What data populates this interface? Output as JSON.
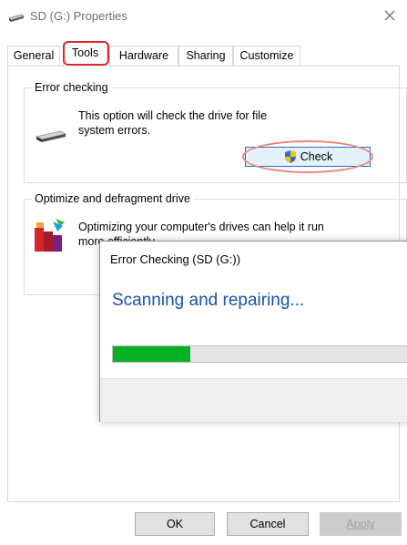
{
  "window": {
    "title": "SD (G:) Properties",
    "title_icon": "drive-icon",
    "close_icon": "close-icon"
  },
  "tabs": [
    {
      "label": "General",
      "active": false
    },
    {
      "label": "Tools",
      "active": true
    },
    {
      "label": "Hardware",
      "active": false
    },
    {
      "label": "Sharing",
      "active": false
    },
    {
      "label": "Customize",
      "active": false
    }
  ],
  "error_checking": {
    "label": "Error checking",
    "line1": "This option will check the drive for file",
    "line2": "system errors.",
    "check_label": "Check",
    "check_icon": "uac-shield-icon"
  },
  "optimize": {
    "label": "Optimize and defragment drive",
    "line1": "Optimizing your computer's drives can help it run",
    "line2": "more efficiently."
  },
  "dialog": {
    "title": "Error Checking (SD (G:))",
    "heading": "Scanning and repairing...",
    "progress": 0.25
  },
  "buttons": {
    "ok": "OK",
    "cancel": "Cancel",
    "apply": "Apply"
  },
  "colors": {
    "highlight_red": "#e0262d",
    "progress_green": "#06b025",
    "heading_blue": "#1a52a6"
  }
}
